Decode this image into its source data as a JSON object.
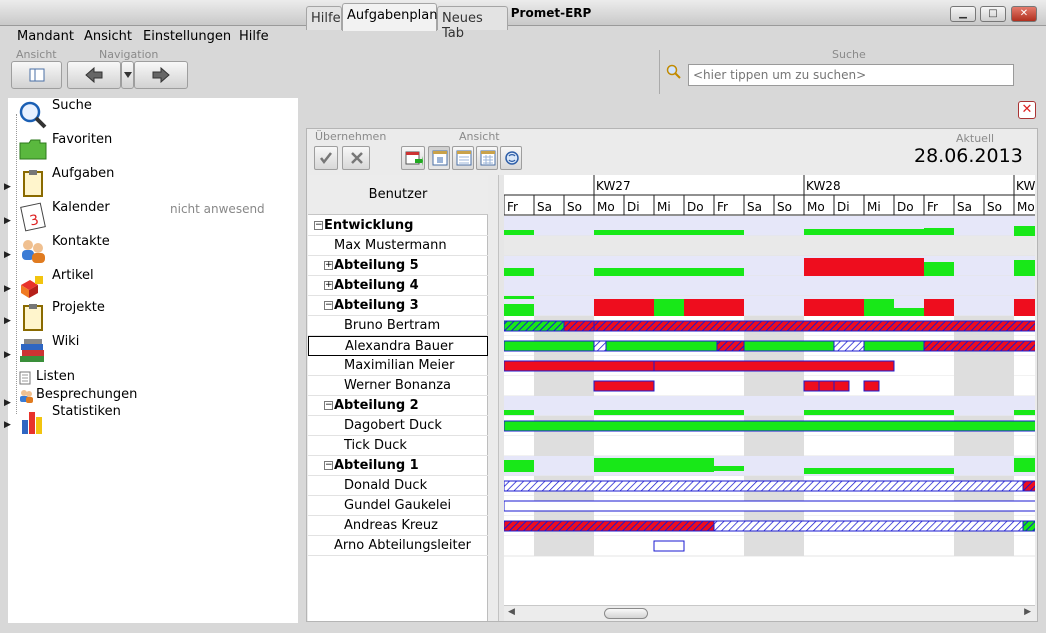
{
  "window": {
    "title": "Test_B - Promet-ERP",
    "btn_min": "▁",
    "btn_max": "□",
    "btn_close": "✕"
  },
  "menu": [
    "Mandant",
    "Ansicht",
    "Einstellungen",
    "Hilfe"
  ],
  "toolbar": {
    "ansicht_label": "Ansicht",
    "navigation_label": "Navigation",
    "suche_label": "Suche",
    "search_placeholder": "<hier tippen um zu suchen>"
  },
  "sidebar": {
    "items": [
      {
        "label": "Suche",
        "icon": "search-icon",
        "arrow": false
      },
      {
        "label": "Favoriten",
        "icon": "folder-icon",
        "arrow": false
      },
      {
        "label": "Aufgaben",
        "icon": "clipboard-icon",
        "arrow": true
      },
      {
        "label": "Kalender",
        "icon": "calendar-icon",
        "arrow": true,
        "status": "nicht anwesend"
      },
      {
        "label": "Kontakte",
        "icon": "contacts-icon",
        "arrow": true
      },
      {
        "label": "Artikel",
        "icon": "articles-icon",
        "arrow": true
      },
      {
        "label": "Projekte",
        "icon": "projects-icon",
        "arrow": true
      },
      {
        "label": "Wiki",
        "icon": "books-icon",
        "arrow": true
      },
      {
        "label": "Listen",
        "icon": "list-icon",
        "arrow": false
      },
      {
        "label": "Besprechungen",
        "icon": "meeting-icon",
        "arrow": true
      },
      {
        "label": "Statistiken",
        "icon": "chart-icon",
        "arrow": true
      }
    ]
  },
  "tabs": [
    "Hilfe",
    "Aufgabenplan",
    "Neues Tab"
  ],
  "planner": {
    "uebernehmen_label": "Übernehmen",
    "ansicht_label": "Ansicht",
    "aktuell_label": "Aktuell",
    "date": "28.06.2013",
    "benutzer_label": "Benutzer",
    "weeks": [
      "KW27",
      "KW28",
      "KW"
    ],
    "days": [
      "Fr",
      "Sa",
      "So",
      "Mo",
      "Di",
      "Mi",
      "Do",
      "Fr",
      "Sa",
      "So",
      "Mo",
      "Di",
      "Mi",
      "Do",
      "Fr",
      "Sa",
      "So",
      "Mo"
    ],
    "users": [
      {
        "name": "Entwicklung",
        "bold": true,
        "expander": "−",
        "level": 0
      },
      {
        "name": "Max Mustermann",
        "bold": false,
        "level": 1
      },
      {
        "name": "Abteilung 5",
        "bold": true,
        "expander": "+",
        "level": 1
      },
      {
        "name": "Abteilung 4",
        "bold": true,
        "expander": "+",
        "level": 1
      },
      {
        "name": "Abteilung 3",
        "bold": true,
        "expander": "−",
        "level": 1
      },
      {
        "name": "Bruno Bertram",
        "bold": false,
        "level": 2
      },
      {
        "name": "Alexandra Bauer",
        "bold": false,
        "level": 2,
        "selected": true
      },
      {
        "name": "Maximilian Meier",
        "bold": false,
        "level": 2
      },
      {
        "name": "Werner Bonanza",
        "bold": false,
        "level": 2
      },
      {
        "name": "Abteilung 2",
        "bold": true,
        "expander": "−",
        "level": 1
      },
      {
        "name": "Dagobert Duck",
        "bold": false,
        "level": 2
      },
      {
        "name": "Tick Duck",
        "bold": false,
        "level": 2
      },
      {
        "name": "Abteilung 1",
        "bold": true,
        "expander": "−",
        "level": 1
      },
      {
        "name": "Donald Duck",
        "bold": false,
        "level": 2
      },
      {
        "name": "Gundel Gaukelei",
        "bold": false,
        "level": 2
      },
      {
        "name": "Andreas Kreuz",
        "bold": false,
        "level": 2
      },
      {
        "name": "Arno Abteilungsleiter",
        "bold": false,
        "level": 1
      }
    ]
  },
  "colors": {
    "green": "#18e818",
    "red": "#ee0d1e",
    "blue": "#1a1ad0",
    "weekend": "#dedede",
    "lavender": "#e6e7f9"
  }
}
